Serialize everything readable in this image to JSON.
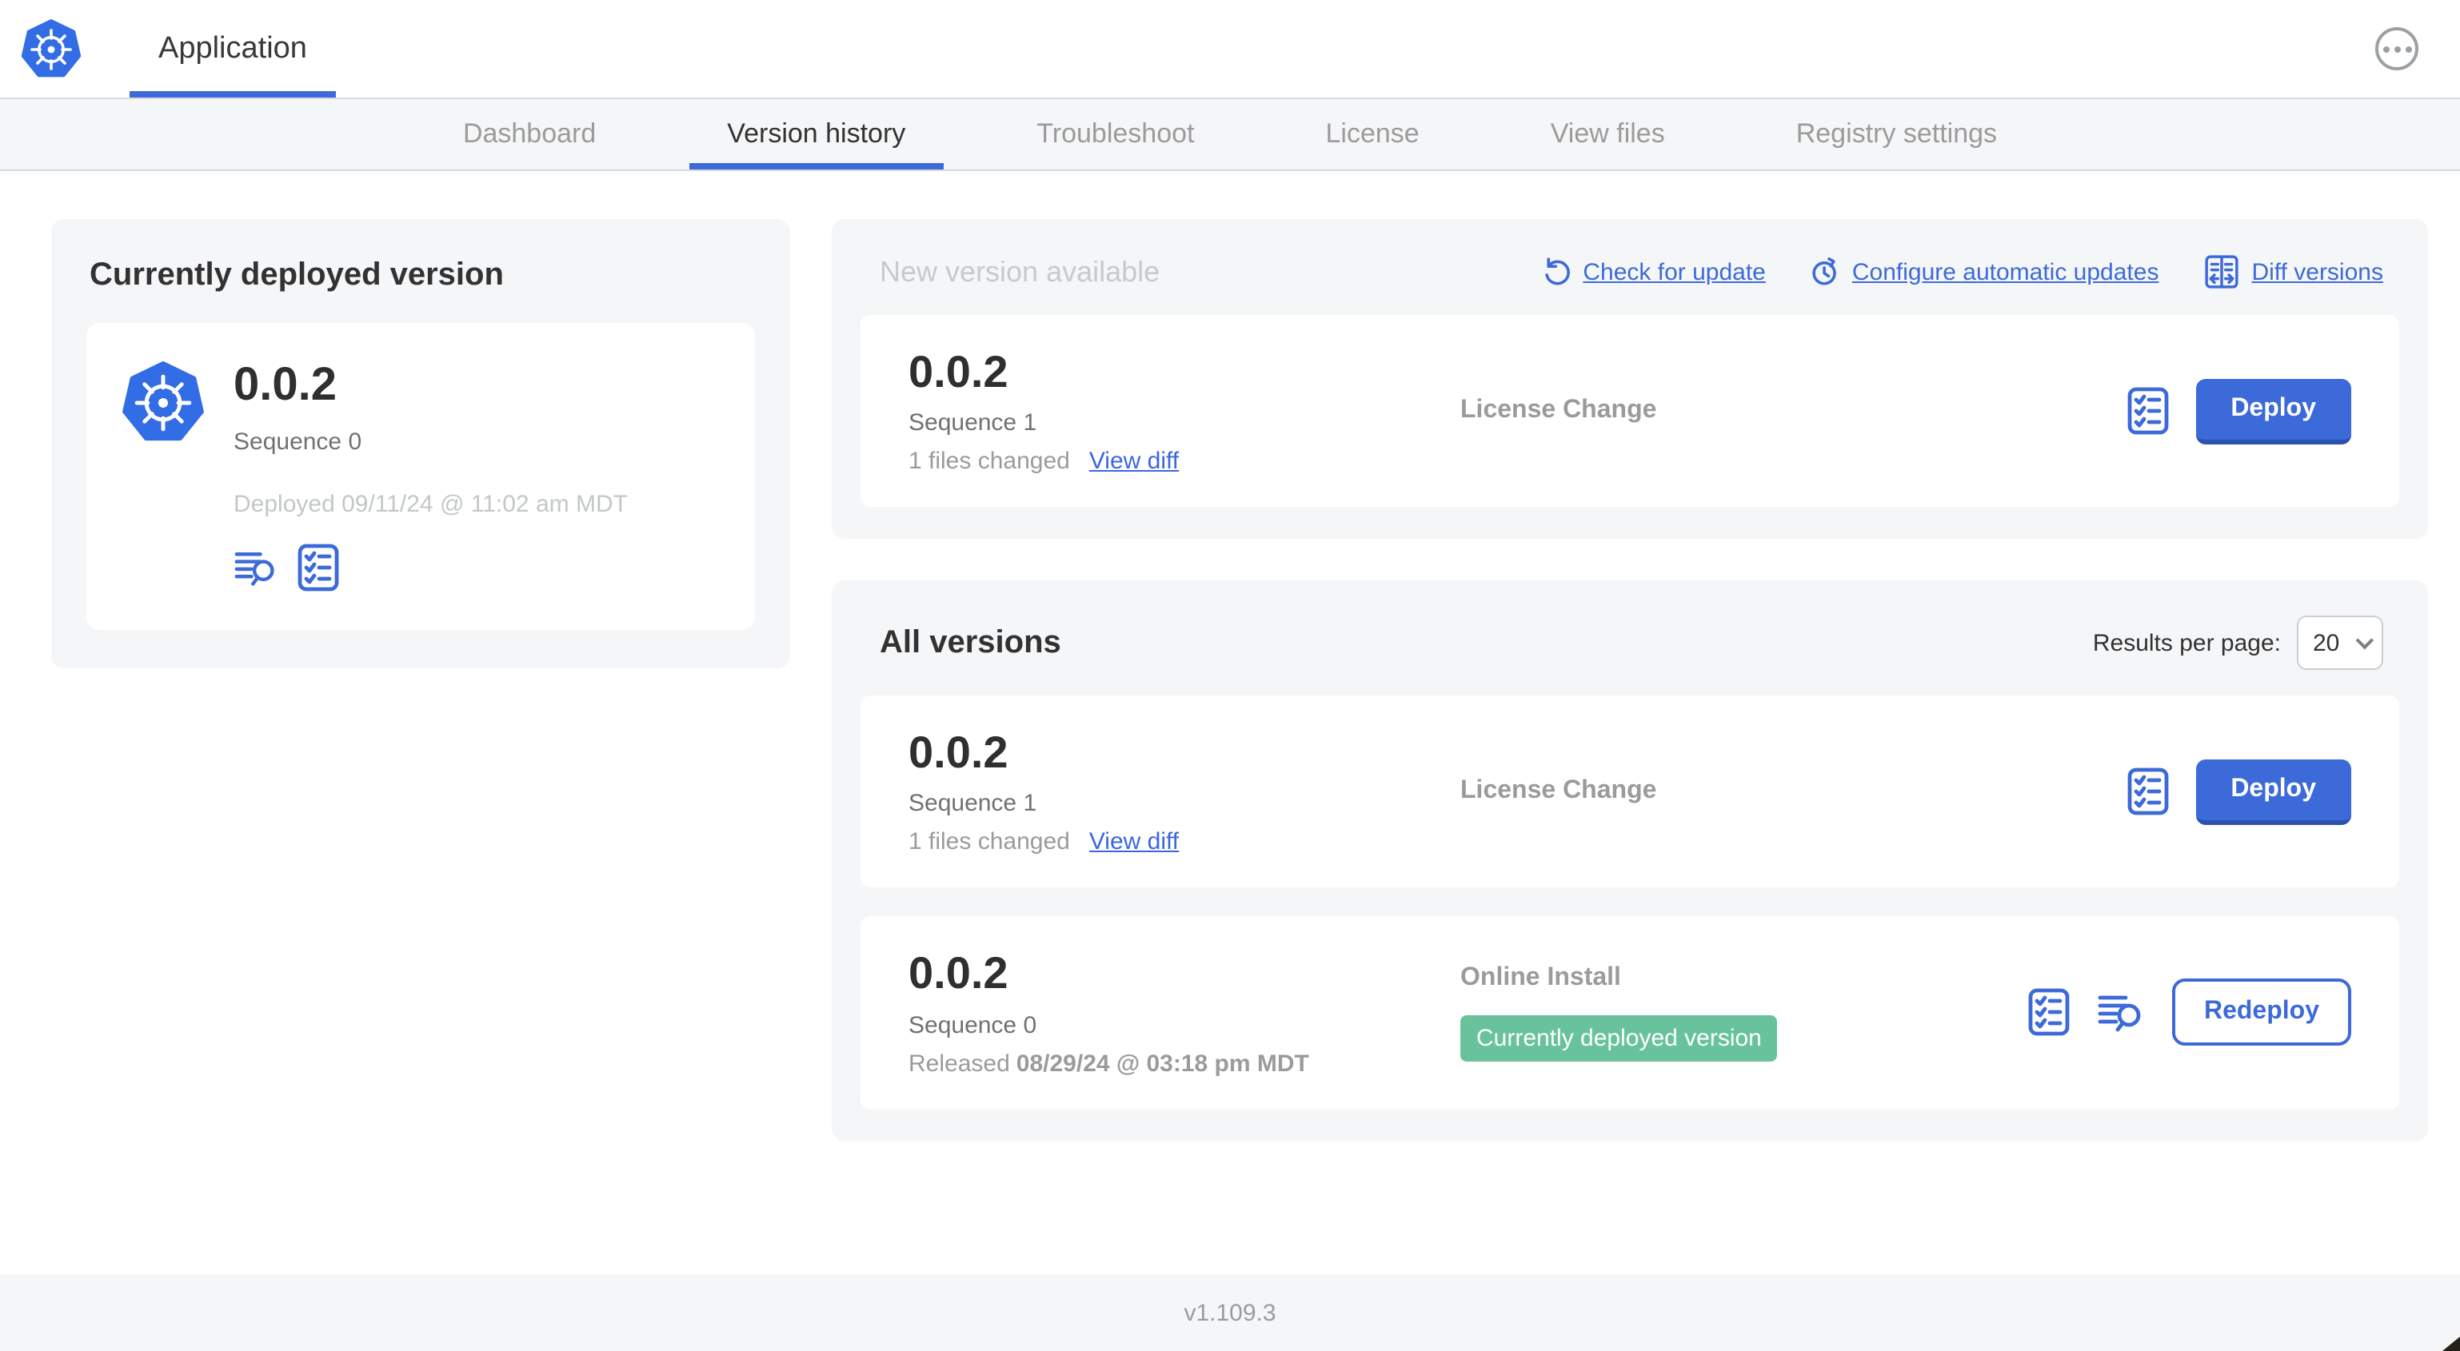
{
  "header": {
    "app_title": "Application"
  },
  "nav": {
    "active_tab": "Version history",
    "tabs": [
      {
        "label": "Dashboard"
      },
      {
        "label": "Version history"
      },
      {
        "label": "Troubleshoot"
      },
      {
        "label": "License"
      },
      {
        "label": "View files"
      },
      {
        "label": "Registry settings"
      }
    ]
  },
  "current_deployed": {
    "title": "Currently deployed version",
    "version": "0.0.2",
    "sequence": "Sequence 0",
    "deployed_at": "Deployed 09/11/24 @ 11:02 am MDT"
  },
  "new_version": {
    "title": "New version available",
    "actions": [
      {
        "label": "Check for update",
        "icon": "refresh-icon"
      },
      {
        "label": "Configure automatic updates",
        "icon": "clock-refresh-icon"
      },
      {
        "label": "Diff versions",
        "icon": "diff-icon"
      }
    ],
    "card": {
      "version": "0.0.2",
      "sequence": "Sequence 1",
      "files_changed": "1 files changed",
      "view_diff": "View diff",
      "source": "License Change",
      "action": "Deploy"
    }
  },
  "all_versions": {
    "title": "All versions",
    "results_per_page_label": "Results per page:",
    "results_per_page_value": "20",
    "rows": [
      {
        "version": "0.0.2",
        "sequence": "Sequence 1",
        "files_changed": "1 files changed",
        "view_diff": "View diff",
        "source": "License Change",
        "action": "Deploy"
      },
      {
        "version": "0.0.2",
        "sequence": "Sequence 0",
        "released_prefix": "Released",
        "released_date": "08/29/24 @ 03:18 pm MDT",
        "source": "Online Install",
        "badge": "Currently deployed version",
        "action": "Redeploy"
      }
    ]
  },
  "footer": {
    "app_version": "v1.109.3"
  },
  "colors": {
    "accent_blue": "#3d6ad9",
    "kubernetes_blue": "#326de6",
    "badge_green": "#68c39c",
    "section_bg": "#f5f6f8",
    "dark_text": "#323232",
    "muted_text": "#9b9b9b",
    "light_text": "#c6cacc"
  }
}
